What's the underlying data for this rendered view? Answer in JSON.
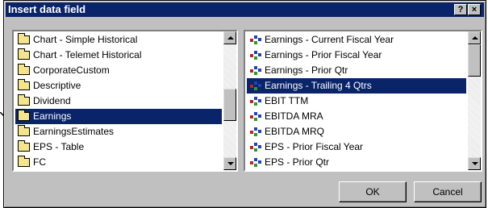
{
  "window": {
    "title": "Insert data field",
    "help_label": "?",
    "close_label": "×"
  },
  "categories": {
    "items": [
      {
        "label": "Chart - Simple Historical",
        "selected": false
      },
      {
        "label": "Chart - Telemet Historical",
        "selected": false
      },
      {
        "label": "CorporateCustom",
        "selected": false
      },
      {
        "label": "Descriptive",
        "selected": false
      },
      {
        "label": "Dividend",
        "selected": false
      },
      {
        "label": "Earnings",
        "selected": true
      },
      {
        "label": "EarningsEstimates",
        "selected": false
      },
      {
        "label": "EPS - Table",
        "selected": false
      },
      {
        "label": "FC",
        "selected": false
      }
    ],
    "icon": "folder-icon",
    "scroll_position": 0.55
  },
  "fields": {
    "items": [
      {
        "label": "Earnings - Current Fiscal Year",
        "selected": false
      },
      {
        "label": "Earnings - Prior Fiscal Year",
        "selected": false
      },
      {
        "label": "Earnings - Prior Qtr",
        "selected": false
      },
      {
        "label": "Earnings - Trailing 4 Qtrs",
        "selected": true
      },
      {
        "label": "EBIT TTM",
        "selected": false
      },
      {
        "label": "EBITDA MRA",
        "selected": false
      },
      {
        "label": "EBITDA MRQ",
        "selected": false
      },
      {
        "label": "EPS - Prior Fiscal Year",
        "selected": false
      },
      {
        "label": "EPS - Prior Qtr",
        "selected": false
      }
    ],
    "icon": "data-field-icon",
    "scroll_position": 0.0
  },
  "buttons": {
    "ok_label": "OK",
    "cancel_label": "Cancel"
  },
  "colors": {
    "dialog_bg": "#c0c0c0",
    "titlebar_bg": "#0a246a",
    "selection_bg": "#0a246a",
    "folder": "#f4e48c"
  }
}
